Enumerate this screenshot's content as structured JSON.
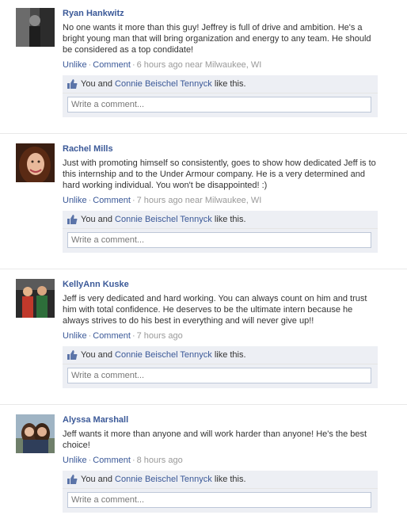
{
  "posts": [
    {
      "author": "Ryan Hankwitz",
      "text": "No one wants it more than this guy! Jeffrey is full of drive and ambition. He's a bright young man that will bring organization and energy to any team. He should be considered as a top condidate!",
      "unlike": "Unlike",
      "comment": "Comment",
      "time": "6 hours ago near Milwaukee, WI",
      "likes_prefix": "You and",
      "likes_name": "Connie Beischel Tennyck",
      "likes_suffix": "like this.",
      "comment_placeholder": "Write a comment..."
    },
    {
      "author": "Rachel Mills",
      "text": "Just with promoting himself so consistently, goes to show how dedicated Jeff is to this internship and to the Under Armour company. He is a very determined and hard working individual. You won't be disappointed! :)",
      "unlike": "Unlike",
      "comment": "Comment",
      "time": "7 hours ago near Milwaukee, WI",
      "likes_prefix": "You and",
      "likes_name": "Connie Beischel Tennyck",
      "likes_suffix": "like this.",
      "comment_placeholder": "Write a comment..."
    },
    {
      "author": "KellyAnn Kuske",
      "text": "Jeff is very dedicated and hard working. You can always count on him and trust him with total confidence. He deserves to be the ultimate intern because he always strives to do his best in everything and will never give up!!",
      "unlike": "Unlike",
      "comment": "Comment",
      "time": "7 hours ago",
      "likes_prefix": "You and",
      "likes_name": "Connie Beischel Tennyck",
      "likes_suffix": "like this.",
      "comment_placeholder": "Write a comment..."
    },
    {
      "author": "Alyssa Marshall",
      "text": "Jeff wants it more than anyone and will work harder than anyone! He's the best choice!",
      "unlike": "Unlike",
      "comment": "Comment",
      "time": "8 hours ago",
      "likes_prefix": "You and",
      "likes_name": "Connie Beischel Tennyck",
      "likes_suffix": "like this.",
      "comment_placeholder": "Write a comment..."
    }
  ],
  "colors": {
    "link": "#3b5998",
    "meta": "#999999",
    "likes_bg": "#edeff4"
  },
  "icons": {
    "like": "thumbs-up-icon"
  }
}
